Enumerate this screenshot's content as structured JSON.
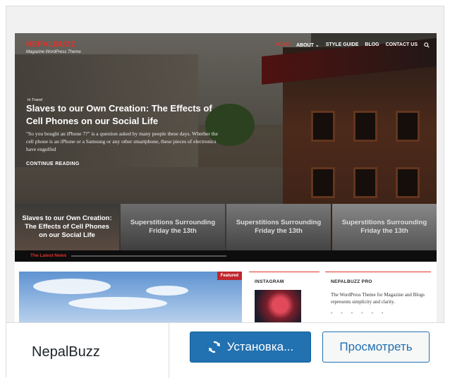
{
  "preview": {
    "site_title": "NEPALBUZZ",
    "tagline": "Magazine WordPress Theme",
    "nav": [
      "HOME",
      "ABOUT ⌄",
      "STYLE GUIDE",
      "BLOG",
      "CONTACT US"
    ],
    "search_icon": "search-icon",
    "hero": {
      "category": "In Travel",
      "title": "Slaves to our Own Creation: The Effects of Cell Phones on our Social Life",
      "excerpt": "\"So you bought an iPhone 7?\" is a question asked by many people these days. Whether the cell phone is an iPhone or a Samsung or any other smartphone, these pieces of electronics have engulfed",
      "read_more": "CONTINUE READING"
    },
    "slider_thumbs": [
      "Slaves to our Own Creation: The Effects of Cell Phones on our Social Life",
      "Superstitions Surrounding Friday the 13th",
      "Superstitions Surrounding Friday the 13th",
      "Superstitions Surrounding Friday the 13th"
    ],
    "ticker_label": "The Latest News",
    "featured_badge": "Featured",
    "instagram_title": "INSTAGRAM",
    "about_title": "NEPALBUZZ PRO",
    "about_text": "The WordPress Theme for Magazine and Blogs represents simplicity and clarity."
  },
  "footer": {
    "theme_name": "NepalBuzz",
    "install_label": "Установка...",
    "preview_label": "Просмотреть"
  },
  "colors": {
    "accent": "#e0322b",
    "wp_blue": "#2271b1"
  }
}
